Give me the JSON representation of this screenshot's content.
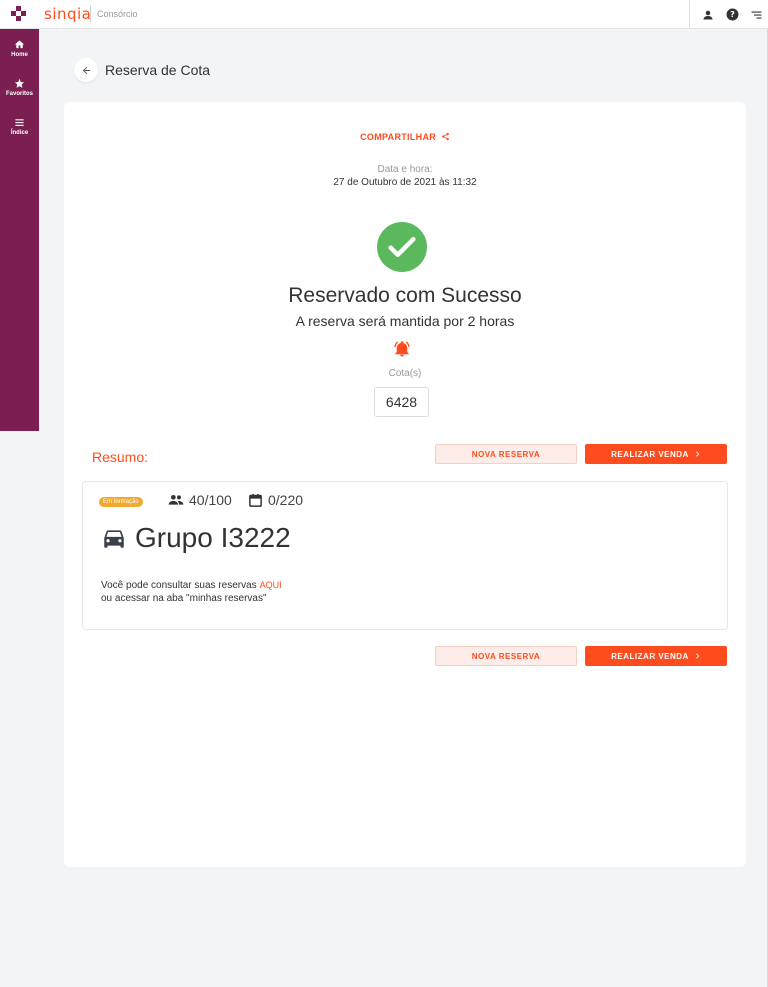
{
  "brand": {
    "name": "sinqia",
    "app": "Consórcio",
    "primary": "#ff4c1f",
    "sidebar": "#7b1f52"
  },
  "header_icons": [
    "user-icon",
    "help-icon",
    "menu-lines-icon"
  ],
  "sidebar": {
    "items": [
      {
        "label": "Home",
        "icon": "home-icon"
      },
      {
        "label": "Favoritos",
        "icon": "star-icon"
      },
      {
        "label": "Índice",
        "icon": "list-icon"
      }
    ]
  },
  "page": {
    "title": "Reserva de Cota"
  },
  "result": {
    "share_label": "COMPARTILHAR",
    "datetime_label": "Data e hora:",
    "datetime_value": "27 de Outubro de 2021 às 11:32",
    "title": "Reservado com Sucesso",
    "subtitle": "A reserva será mantida por 2 horas",
    "cota_label": "Cota(s)",
    "cota_value": "6428"
  },
  "summary": {
    "title": "Resumo:",
    "nova_reserva": "NOVA RESERVA",
    "realizar_venda": "REALIZAR VENDA"
  },
  "group": {
    "status": "Em formação",
    "status_color": "#f0a92e",
    "members": "40/100",
    "term": "0/220",
    "name": "Grupo I3222",
    "info_line1": "Você pode consultar suas reservas",
    "info_link": "AQUI",
    "info_line2": "ou acessar na aba \"minhas reservas\""
  },
  "success_color": "#5cb85c"
}
